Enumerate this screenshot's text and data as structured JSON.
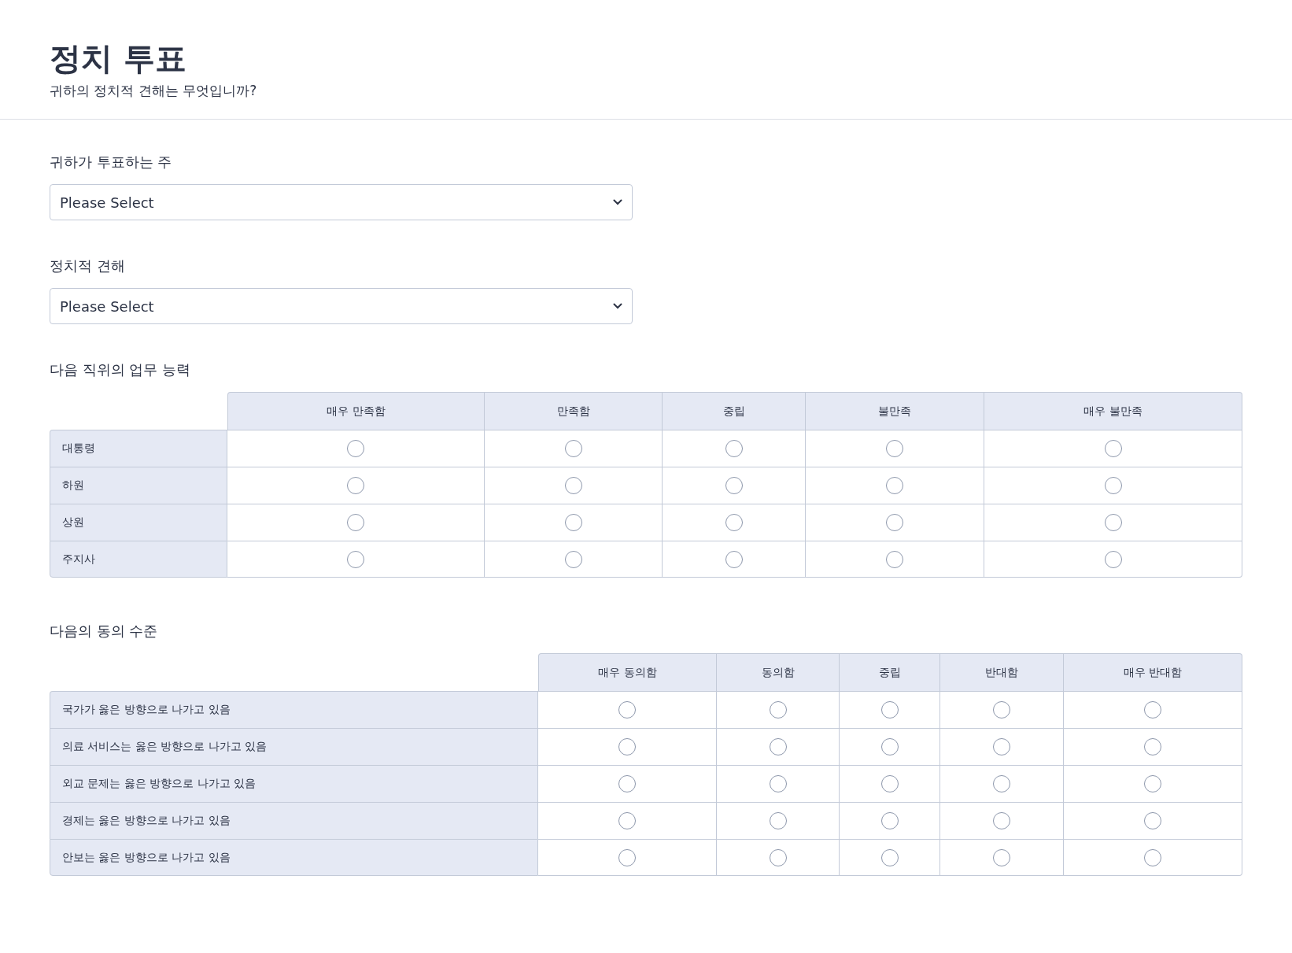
{
  "header": {
    "title": "정치 투표",
    "subtitle": "귀하의 정치적 견해는 무엇입니까?"
  },
  "dropdowns": [
    {
      "label": "귀하가 투표하는 주",
      "placeholder": "Please Select"
    },
    {
      "label": "정치적 견해",
      "placeholder": "Please Select"
    }
  ],
  "matrices": [
    {
      "label": "다음 직위의 업무 능력",
      "kind": "narrow",
      "columns": [
        "매우 만족함",
        "만족함",
        "중립",
        "불만족",
        "매우 불만족"
      ],
      "rows": [
        {
          "label": "대통령",
          "selected": [
            false,
            false,
            false,
            false,
            false
          ]
        },
        {
          "label": "하원",
          "selected": [
            false,
            false,
            false,
            false,
            false
          ]
        },
        {
          "label": "상원",
          "selected": [
            false,
            false,
            false,
            false,
            false
          ]
        },
        {
          "label": "주지사",
          "selected": [
            false,
            false,
            false,
            false,
            false
          ]
        }
      ]
    },
    {
      "label": "다음의 동의 수준",
      "kind": "wide",
      "columns": [
        "매우 동의함",
        "동의함",
        "중립",
        "반대함",
        "매우 반대함"
      ],
      "rows": [
        {
          "label": "국가가 옳은 방향으로 나가고 있음",
          "selected": [
            false,
            false,
            false,
            false,
            false
          ]
        },
        {
          "label": "의료 서비스는 옳은 방향으로 나가고 있음",
          "selected": [
            false,
            false,
            false,
            false,
            false
          ]
        },
        {
          "label": "외교 문제는 옳은 방향으로 나가고 있음",
          "selected": [
            false,
            false,
            false,
            false,
            false
          ]
        },
        {
          "label": "경제는 옳은 방향으로 나가고 있음",
          "selected": [
            false,
            false,
            false,
            false,
            false
          ]
        },
        {
          "label": "안보는 옳은 방향으로 나가고 있음",
          "selected": [
            false,
            false,
            false,
            false,
            false
          ]
        }
      ]
    }
  ]
}
